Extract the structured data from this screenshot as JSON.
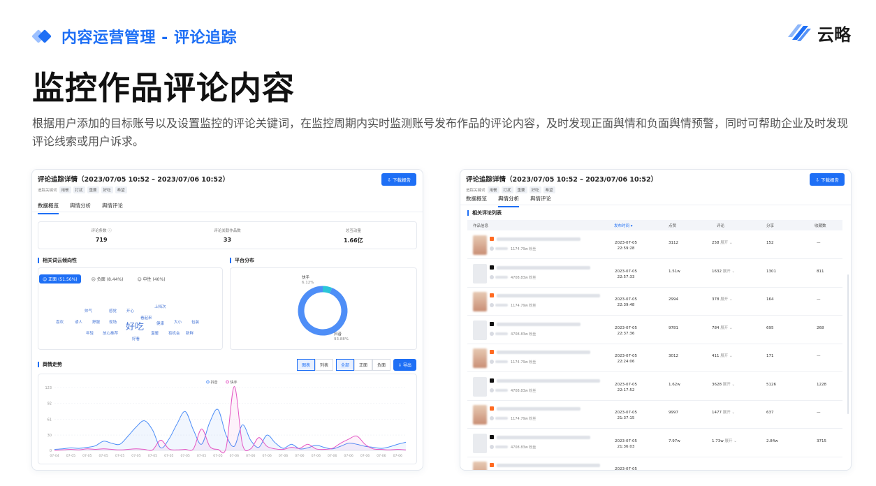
{
  "slide": {
    "section_title": "内容运营管理 - 评论追踪",
    "brand": "云略",
    "main_title": "监控作品评论内容",
    "description": "根据用户添加的目标账号以及设置监控的评论关键词，在监控周期内实时监测账号发布作品的评论内容，及时发现正面舆情和负面舆情预警，同时可帮助企业及时发现评论线索或用户诉求。"
  },
  "panel_common": {
    "title": "评论追踪详情（2023/07/05 10:52 – 2023/07/06 10:52）",
    "keyword_label": "追踪关键词",
    "keywords": [
      "用餐",
      "打扰",
      "重要",
      "好吃",
      "希望"
    ],
    "download_label": "⇩ 下载报告",
    "tabs": [
      "数据概览",
      "舆情分析",
      "舆情评论"
    ]
  },
  "left_panel": {
    "stats": [
      {
        "label": "评论条数 ⓘ",
        "value": "719"
      },
      {
        "label": "评论关联作品数",
        "value": "33"
      },
      {
        "label": "总互动量",
        "value": "1.66亿"
      }
    ],
    "wordcloud_title": "相关词云倾向性",
    "sentiments": [
      "☺ 正面 (51.56%)",
      "☹ 负面 (8.44%)",
      "☺ 中性 (40%)"
    ],
    "words": [
      {
        "text": "帅气",
        "size": 5.5
      },
      {
        "text": "感觉",
        "size": 5.5
      },
      {
        "text": "开心",
        "size": 5.5
      },
      {
        "text": "上档次",
        "size": 5.5
      },
      {
        "text": "看起来",
        "size": 5.5
      },
      {
        "text": "喜欢",
        "size": 5.5
      },
      {
        "text": "诱人",
        "size": 5.5
      },
      {
        "text": "舒服",
        "size": 5.5
      },
      {
        "text": "现场",
        "size": 5.5
      },
      {
        "text": "好吃",
        "size": 13
      },
      {
        "text": "健康",
        "size": 5.5
      },
      {
        "text": "大小",
        "size": 5.5
      },
      {
        "text": "包装",
        "size": 5.5
      },
      {
        "text": "年轻",
        "size": 5.5
      },
      {
        "text": "放心推荐",
        "size": 5.5
      },
      {
        "text": "温暖",
        "size": 5.5
      },
      {
        "text": "有机会",
        "size": 5.5
      },
      {
        "text": "新鲜",
        "size": 5.5
      },
      {
        "text": "好看",
        "size": 5.5
      }
    ],
    "platform_title": "平台分布",
    "platform_dist": [
      {
        "name": "快手",
        "pct": "6.12%",
        "value": 6.12,
        "color": "#2bc5d8"
      },
      {
        "name": "抖音",
        "pct": "93.88%",
        "value": 93.88,
        "color": "#4e8ef7"
      }
    ],
    "trend_title": "舆情走势",
    "view_toggle": [
      "图表",
      "列表"
    ],
    "filter_toggle": [
      "全部",
      "正面",
      "负面"
    ],
    "export_label": "⇩ 导出"
  },
  "chart_data": {
    "type": "line",
    "title": "舆情走势",
    "xlabel": "",
    "ylabel": "",
    "ylim": [
      0,
      123
    ],
    "yticks": [
      0,
      30,
      61,
      92,
      123
    ],
    "legend_position": "top-center",
    "grid": true,
    "x": [
      "07-04",
      "07-05",
      "07-05",
      "07-05",
      "07-05",
      "07-05",
      "07-05",
      "07-05",
      "07-05",
      "07-05",
      "07-05",
      "07-05",
      "07-05",
      "07-05",
      "07-05",
      "07-05",
      "07-05",
      "07-05",
      "07-05",
      "07-05",
      "07-05",
      "07-05",
      "07-06",
      "07-06",
      "07-06",
      "07-06",
      "07-06",
      "07-06",
      "07-06",
      "07-06",
      "07-06",
      "07-06",
      "07-06",
      "07-06",
      "07-06",
      "07-06",
      "07-06",
      "07-06",
      "07-06",
      "07-06",
      "07-06",
      "07-06",
      "07-06",
      "07-06"
    ],
    "series": [
      {
        "name": "抖音",
        "color": "#4e8ef7",
        "values": [
          2,
          3,
          5,
          4,
          6,
          9,
          18,
          14,
          12,
          28,
          46,
          58,
          40,
          5,
          22,
          52,
          76,
          40,
          12,
          55,
          80,
          30,
          8,
          50,
          20,
          6,
          30,
          15,
          4,
          12,
          3,
          5,
          10,
          6,
          3,
          8,
          14,
          12,
          8,
          6,
          4,
          7,
          12,
          16
        ]
      },
      {
        "name": "快手",
        "color": "#e456c4",
        "values": [
          0,
          1,
          2,
          1,
          3,
          2,
          3,
          2,
          1,
          2,
          3,
          2,
          1,
          20,
          3,
          1,
          2,
          3,
          42,
          8,
          2,
          5,
          125,
          12,
          3,
          25,
          8,
          3,
          2,
          6,
          4,
          12,
          3,
          2,
          4,
          14,
          22,
          28,
          12,
          3,
          2,
          1,
          2,
          1
        ]
      }
    ]
  },
  "right_panel": {
    "list_title": "相关评论列表",
    "columns": [
      "作品信息",
      "发布时间 ▾",
      "点赞",
      "评论",
      "分享",
      "收藏数"
    ],
    "expand_label": "展开",
    "rows": [
      {
        "platform": "kuaishou",
        "fans": "1174.79w 粉丝",
        "date": "2023-07-05",
        "time": "22:59:28",
        "likes": "3112",
        "comments": "258",
        "shares": "152",
        "favs": "—"
      },
      {
        "platform": "douyin",
        "fans": "4708.83w 粉丝",
        "date": "2023-07-05",
        "time": "22:57:33",
        "likes": "1.51w",
        "comments": "1632",
        "shares": "1301",
        "favs": "811"
      },
      {
        "platform": "kuaishou",
        "fans": "1174.79w 粉丝",
        "date": "2023-07-05",
        "time": "22:39:48",
        "likes": "2994",
        "comments": "378",
        "shares": "164",
        "favs": "—"
      },
      {
        "platform": "douyin",
        "fans": "4708.83w 粉丝",
        "date": "2023-07-05",
        "time": "22:37:36",
        "likes": "9781",
        "comments": "784",
        "shares": "695",
        "favs": "268"
      },
      {
        "platform": "kuaishou",
        "fans": "1174.79w 粉丝",
        "date": "2023-07-05",
        "time": "22:24:06",
        "likes": "3012",
        "comments": "411",
        "shares": "171",
        "favs": "—"
      },
      {
        "platform": "douyin",
        "fans": "4708.83w 粉丝",
        "date": "2023-07-05",
        "time": "22:17:52",
        "likes": "1.62w",
        "comments": "3628",
        "shares": "5126",
        "favs": "1228"
      },
      {
        "platform": "kuaishou",
        "fans": "1174.79w 粉丝",
        "date": "2023-07-05",
        "time": "21:37:15",
        "likes": "9997",
        "comments": "1477",
        "shares": "637",
        "favs": "—"
      },
      {
        "platform": "douyin",
        "fans": "4708.83w 粉丝",
        "date": "2023-07-05",
        "time": "21:36:03",
        "likes": "7.97w",
        "comments": "1.73w",
        "shares": "2.84w",
        "favs": "3715"
      },
      {
        "platform": "kuaishou",
        "fans": "",
        "date": "2023-07-05",
        "time": "",
        "likes": "",
        "comments": "",
        "shares": "",
        "favs": ""
      }
    ]
  },
  "colors": {
    "accent": "#1e6ff5",
    "kuaishou": "#ff6a21",
    "douyin": "#111111"
  }
}
